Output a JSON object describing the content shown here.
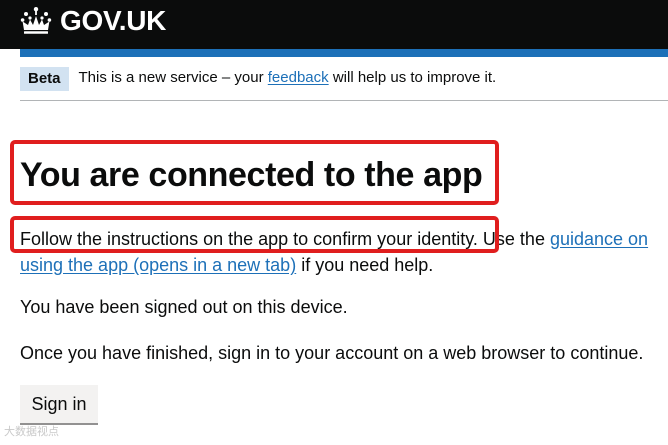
{
  "header": {
    "logo_text": "GOV.UK"
  },
  "phase_banner": {
    "tag": "Beta",
    "text_before": "This is a new service – your",
    "link": "feedback",
    "text_after": "will help us to improve it."
  },
  "main": {
    "heading": "You are connected to the app",
    "instructions_highlighted": "Follow the instructions on the app to confirm your identity.",
    "instructions_mid": "Use the",
    "guidance_link": "guidance on using the app (opens in a new tab)",
    "instructions_end": "if you need help.",
    "signed_out": "You have been signed out on this device.",
    "finished": "Once you have finished, sign in to your account on a web browser to continue.",
    "signin_button": "Sign in"
  },
  "watermark": "大数据视点",
  "colors": {
    "header_bg": "#0b0c0c",
    "brand_blue": "#1d70b8",
    "tag_bg": "#d2e2f1",
    "highlight": "#e01e1e",
    "button_bg": "#f3f2f1"
  },
  "icons": [
    "crown-icon"
  ]
}
